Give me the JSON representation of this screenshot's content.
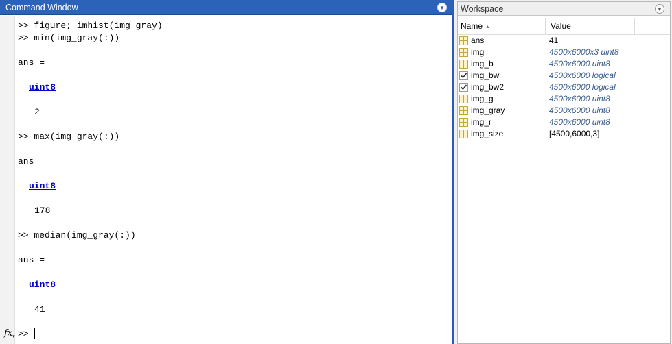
{
  "command_window": {
    "title": "Command Window",
    "lines": [
      {
        "text": ">> figure; imhist(img_gray)",
        "kind": "cmd"
      },
      {
        "text": ">> min(img_gray(:))",
        "kind": "cmd"
      },
      {
        "text": "ans =",
        "kind": "out"
      },
      {
        "text": "uint8",
        "kind": "link"
      },
      {
        "text": "2",
        "kind": "out"
      },
      {
        "text": ">> max(img_gray(:))",
        "kind": "cmd"
      },
      {
        "text": "ans =",
        "kind": "out"
      },
      {
        "text": "uint8",
        "kind": "link"
      },
      {
        "text": "178",
        "kind": "out"
      },
      {
        "text": ">> median(img_gray(:))",
        "kind": "cmd"
      },
      {
        "text": "ans =",
        "kind": "out"
      },
      {
        "text": "uint8",
        "kind": "link"
      },
      {
        "text": "41",
        "kind": "out"
      }
    ],
    "fx_symbol": "fx",
    "prompt": ">>"
  },
  "workspace": {
    "title": "Workspace",
    "columns": {
      "name": "Name",
      "value": "Value"
    },
    "rows": [
      {
        "name": "ans",
        "value": "41",
        "icon": "grid-icon",
        "italic": false
      },
      {
        "name": "img",
        "value": "4500x6000x3 uint8",
        "icon": "grid-icon",
        "italic": true
      },
      {
        "name": "img_b",
        "value": "4500x6000 uint8",
        "icon": "grid-icon",
        "italic": true
      },
      {
        "name": "img_bw",
        "value": "4500x6000 logical",
        "icon": "checkbox-icon",
        "italic": true
      },
      {
        "name": "img_bw2",
        "value": "4500x6000 logical",
        "icon": "checkbox-icon",
        "italic": true
      },
      {
        "name": "img_g",
        "value": "4500x6000 uint8",
        "icon": "grid-icon",
        "italic": true
      },
      {
        "name": "img_gray",
        "value": "4500x6000 uint8",
        "icon": "grid-icon",
        "italic": true
      },
      {
        "name": "img_r",
        "value": "4500x6000 uint8",
        "icon": "grid-icon",
        "italic": true
      },
      {
        "name": "img_size",
        "value": "[4500,6000,3]",
        "icon": "grid-icon",
        "italic": false
      }
    ]
  },
  "colors": {
    "titlebar_active": "#2a63b8",
    "link": "#0000c8",
    "workspace_value_italic": "#3d5e8c"
  }
}
